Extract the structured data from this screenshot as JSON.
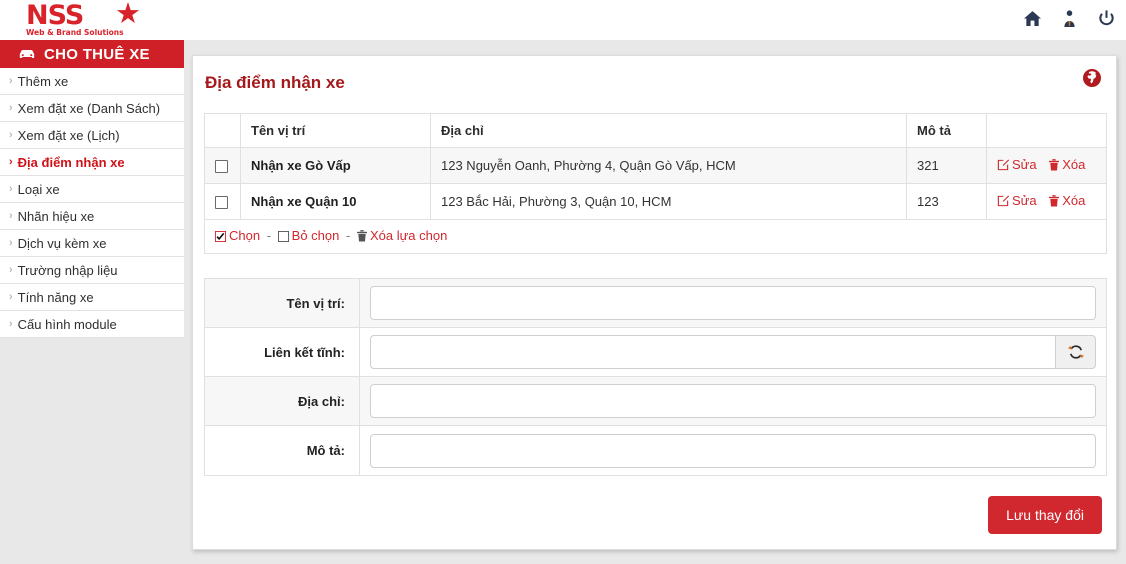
{
  "brand": {
    "name": "NSS",
    "tagline": "Web & Brand Solutions",
    "star": "★",
    "accent": "#d8232a"
  },
  "topbar": {
    "icons": [
      {
        "name": "home-icon",
        "title": "Trang chủ"
      },
      {
        "name": "user-tie-icon",
        "title": "Tài khoản"
      },
      {
        "name": "power-icon",
        "title": "Đăng xuất"
      }
    ]
  },
  "sidebar": {
    "header": "CHO THUÊ XE",
    "items": [
      {
        "label": "Thêm xe",
        "active": false
      },
      {
        "label": "Xem đặt xe (Danh Sách)",
        "active": false
      },
      {
        "label": "Xem đặt xe (Lịch)",
        "active": false
      },
      {
        "label": "Địa điểm nhận xe",
        "active": true
      },
      {
        "label": "Loại xe",
        "active": false
      },
      {
        "label": "Nhãn hiệu xe",
        "active": false
      },
      {
        "label": "Dịch vụ kèm xe",
        "active": false
      },
      {
        "label": "Trường nhập liệu",
        "active": false
      },
      {
        "label": "Tính năng xe",
        "active": false
      },
      {
        "label": "Cấu hình module",
        "active": false
      }
    ]
  },
  "panel": {
    "title": "Địa điểm nhận xe",
    "title_color": "#a5191c",
    "globe_icon": "globe-icon"
  },
  "table": {
    "columns": [
      "",
      "Tên vị trí",
      "Địa chỉ",
      "Mô tả",
      ""
    ],
    "rows": [
      {
        "checked": false,
        "name": "Nhận xe Gò Vấp",
        "address": "123 Nguyễn Oanh, Phường 4, Quận Gò Vấp, HCM",
        "description": "321",
        "edit_label": "Sửa",
        "delete_label": "Xóa"
      },
      {
        "checked": false,
        "name": "Nhận xe Quận 10",
        "address": "123 Bắc Hải, Phường 3, Quận 10, HCM",
        "description": "123",
        "edit_label": "Sửa",
        "delete_label": "Xóa"
      }
    ],
    "footer": {
      "select_all": "Chọn",
      "deselect_all": "Bỏ chọn",
      "delete_selected": "Xóa lựa chọn",
      "separator": "-"
    }
  },
  "form": {
    "fields": [
      {
        "label": "Tên vị trí:",
        "value": "",
        "placeholder": "",
        "addon": null
      },
      {
        "label": "Liên kết tĩnh:",
        "value": "",
        "placeholder": "",
        "addon": "refresh-icon"
      },
      {
        "label": "Địa chỉ:",
        "value": "",
        "placeholder": "",
        "addon": null
      },
      {
        "label": "Mô tả:",
        "value": "",
        "placeholder": "",
        "addon": null
      }
    ],
    "save_label": "Lưu thay đổi",
    "save_color": "#d0282e"
  }
}
